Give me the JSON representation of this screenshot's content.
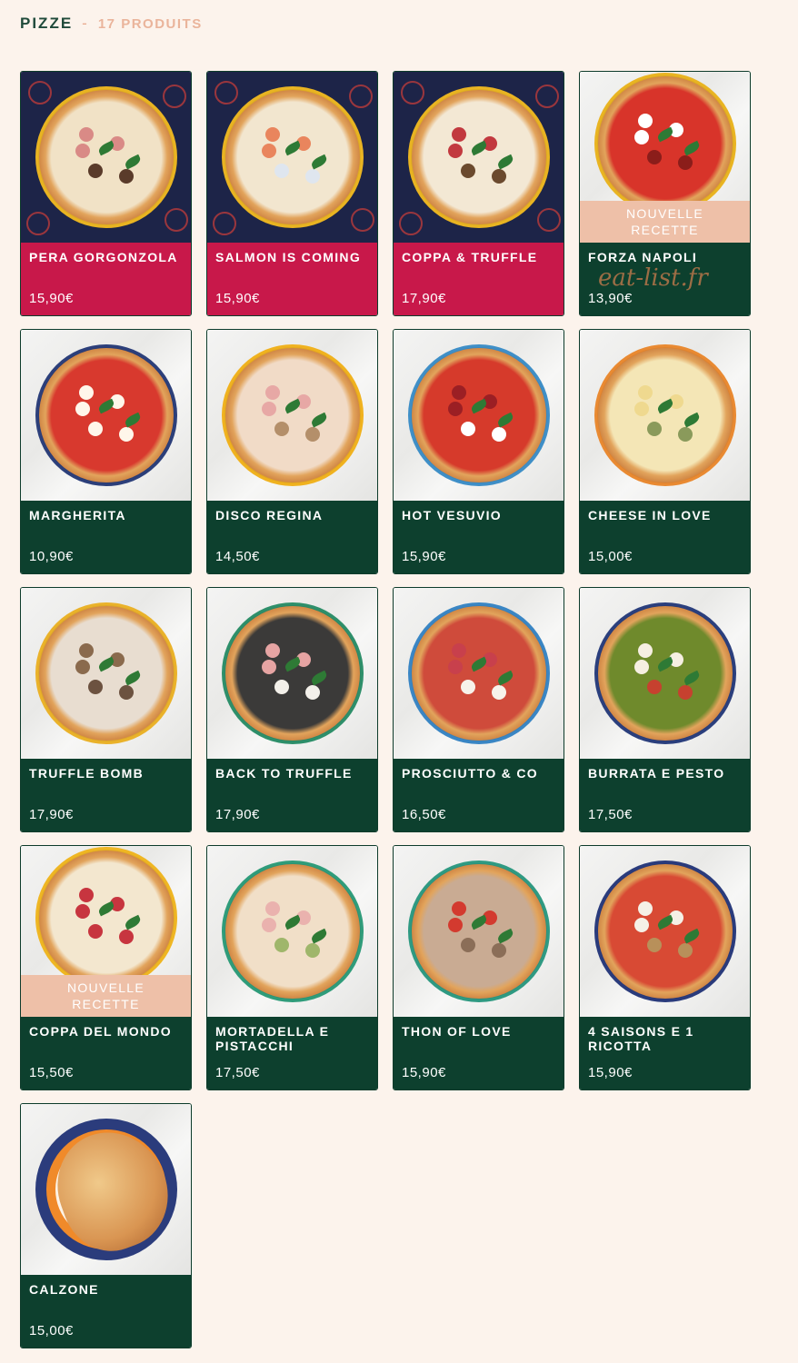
{
  "header": {
    "title": "PIZZE",
    "separator": "-",
    "count": "17 PRODUITS"
  },
  "badge_text": {
    "line1": "NOUVELLE",
    "line2": "RECETTE"
  },
  "watermark": "eat-list.fr",
  "colors": {
    "green": "#0d402e",
    "pink": "#c8184a",
    "badge": "#eec0a8",
    "background": "#fcf3ec"
  },
  "products": [
    {
      "name": "PERA GORGONZOLA",
      "price": "15,90€"
    },
    {
      "name": "SALMON IS COMING",
      "price": "15,90€"
    },
    {
      "name": "COPPA & TRUFFLE",
      "price": "17,90€"
    },
    {
      "name": "FORZA NAPOLI",
      "price": "13,90€"
    },
    {
      "name": "MARGHERITA",
      "price": "10,90€"
    },
    {
      "name": "DISCO REGINA",
      "price": "14,50€"
    },
    {
      "name": "HOT VESUVIO",
      "price": "15,90€"
    },
    {
      "name": "CHEESE IN LOVE",
      "price": "15,00€"
    },
    {
      "name": "TRUFFLE BOMB",
      "price": "17,90€"
    },
    {
      "name": "BACK TO TRUFFLE",
      "price": "17,90€"
    },
    {
      "name": "PROSCIUTTO & CO",
      "price": "16,50€"
    },
    {
      "name": "BURRATA E PESTO",
      "price": "17,50€"
    },
    {
      "name": "COPPA DEL MONDO",
      "price": "15,50€"
    },
    {
      "name": "MORTADELLA E PISTACCHI",
      "price": "17,50€"
    },
    {
      "name": "THON OF LOVE",
      "price": "15,90€"
    },
    {
      "name": "4 SAISONS E 1 RICOTTA",
      "price": "15,90€"
    },
    {
      "name": "CALZONE",
      "price": "15,00€"
    }
  ]
}
